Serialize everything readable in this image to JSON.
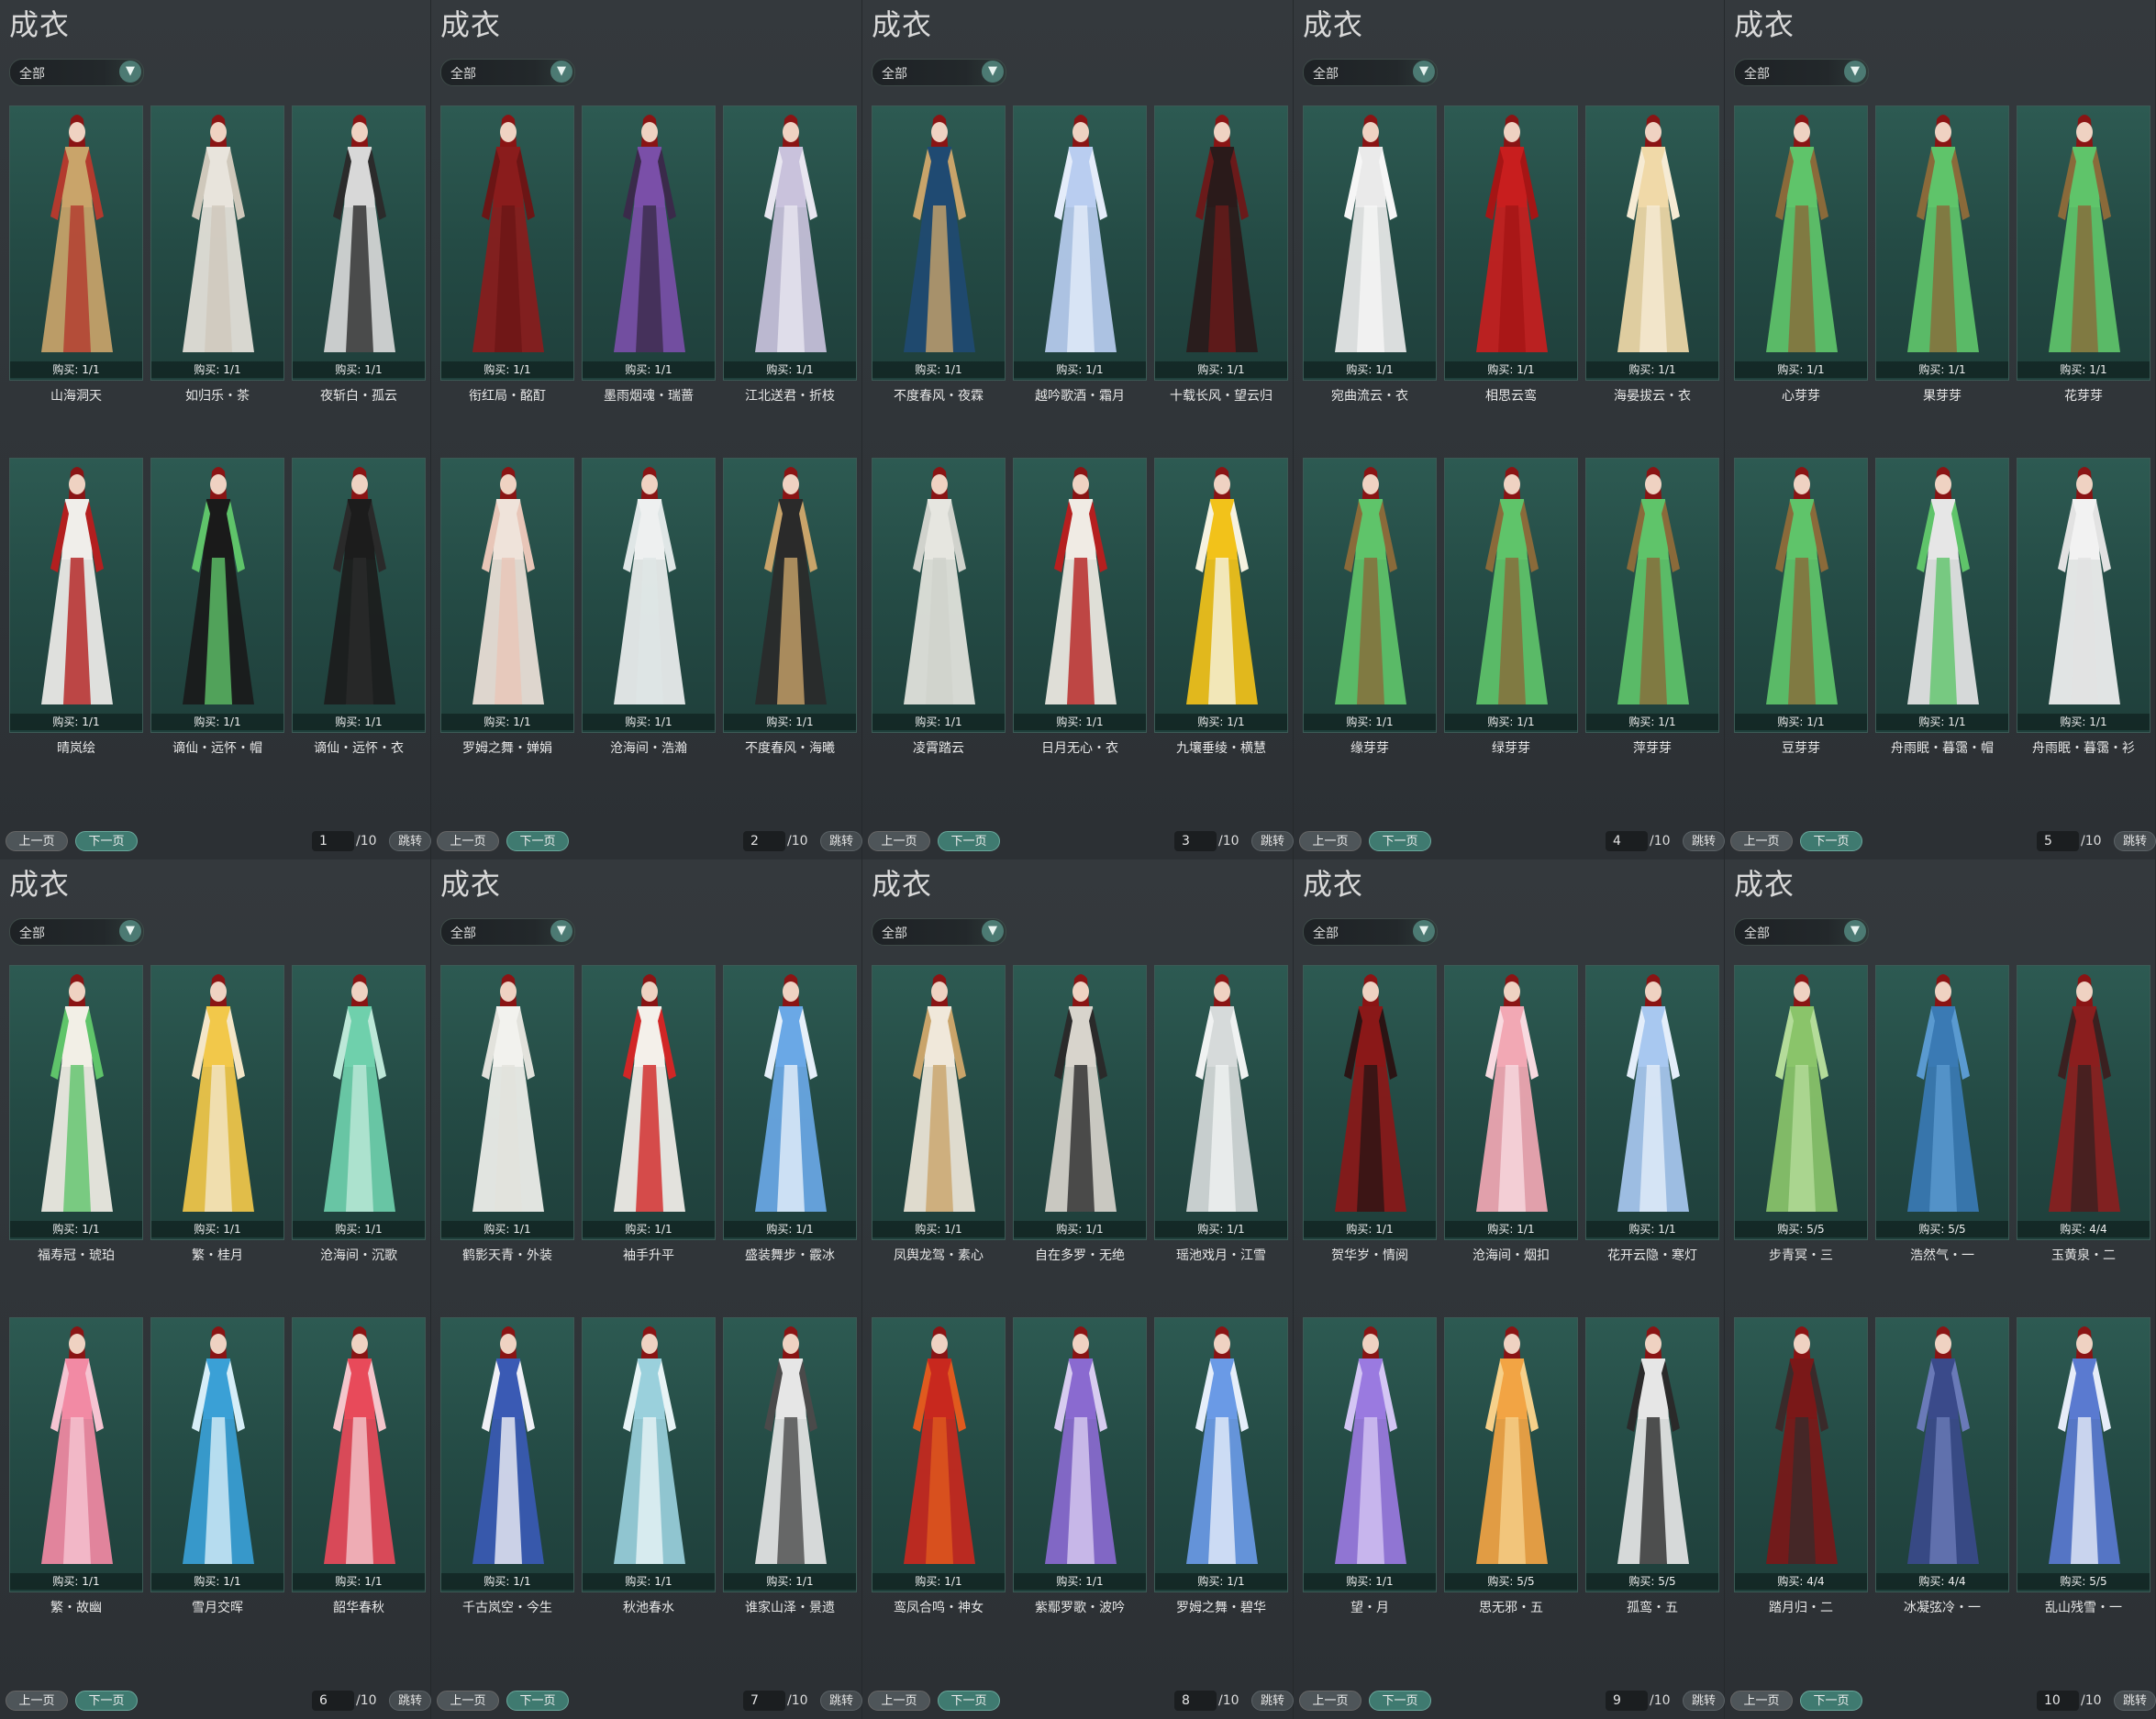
{
  "ui": {
    "title": "成衣",
    "filter_value": "全部",
    "prev_label": "上一页",
    "next_label": "下一页",
    "total_pages": "/10",
    "jump_label": "跳转"
  },
  "pages": [
    {
      "page": "1",
      "items": [
        {
          "name": "山海洞天",
          "buy": "购买: 1/1",
          "colors": [
            "#c9a46a",
            "#b33a2e"
          ]
        },
        {
          "name": "如归乐・茶",
          "buy": "购买: 1/1",
          "colors": [
            "#e8e4dc",
            "#cfc8bb"
          ]
        },
        {
          "name": "夜斩白・孤云",
          "buy": "购买: 1/1",
          "colors": [
            "#d8d8d8",
            "#2b2b2b"
          ]
        },
        {
          "name": "晴岚绘",
          "buy": "购买: 1/1",
          "colors": [
            "#f0eeea",
            "#b31f1f"
          ]
        },
        {
          "name": "谪仙・远怀・帽",
          "buy": "购买: 1/1",
          "colors": [
            "#1a1a1a",
            "#5fc46a"
          ]
        },
        {
          "name": "谪仙・远怀・衣",
          "buy": "购买: 1/1",
          "colors": [
            "#1c1c1c",
            "#2a2a2a"
          ]
        }
      ]
    },
    {
      "page": "2",
      "items": [
        {
          "name": "衔红局・酩酊",
          "buy": "购买: 1/1",
          "colors": [
            "#8a1c1c",
            "#6b1515"
          ]
        },
        {
          "name": "墨雨烟魂・瑞蔷",
          "buy": "购买: 1/1",
          "colors": [
            "#7a4fa8",
            "#3a2a4a"
          ]
        },
        {
          "name": "江北送君・折枝",
          "buy": "购买: 1/1",
          "colors": [
            "#c9c2dc",
            "#e8e6f0"
          ]
        },
        {
          "name": "罗姆之舞・婵娟",
          "buy": "购买: 1/1",
          "colors": [
            "#efe3da",
            "#e8c6b8"
          ]
        },
        {
          "name": "沧海间・浩瀚",
          "buy": "购买: 1/1",
          "colors": [
            "#eef0f0",
            "#dfe6e6"
          ]
        },
        {
          "name": "不度春风・海曦",
          "buy": "购买: 1/1",
          "colors": [
            "#2a2a2a",
            "#c9a46a"
          ]
        }
      ]
    },
    {
      "page": "3",
      "items": [
        {
          "name": "不度春风・夜霖",
          "buy": "购买: 1/1",
          "colors": [
            "#1f4a72",
            "#c9a46a"
          ]
        },
        {
          "name": "越吟歌酒・霜月",
          "buy": "购买: 1/1",
          "colors": [
            "#b9cdf0",
            "#e4ecfa"
          ]
        },
        {
          "name": "十载长风・望云归",
          "buy": "购买: 1/1",
          "colors": [
            "#2a1a1a",
            "#6a1a1a"
          ]
        },
        {
          "name": "凌霄踏云",
          "buy": "购买: 1/1",
          "colors": [
            "#e6e6e0",
            "#d0d2cc"
          ]
        },
        {
          "name": "日月无心・衣",
          "buy": "购买: 1/1",
          "colors": [
            "#f0ebe4",
            "#b51f1f"
          ]
        },
        {
          "name": "九壤垂绫・横慧",
          "buy": "购买: 1/1",
          "colors": [
            "#f2c21a",
            "#f6f2e0"
          ]
        }
      ]
    },
    {
      "page": "4",
      "items": [
        {
          "name": "宛曲流云・衣",
          "buy": "购买: 1/1",
          "colors": [
            "#eaeaea",
            "#f6f6f6"
          ]
        },
        {
          "name": "相思云鸾",
          "buy": "购买: 1/1",
          "colors": [
            "#c81e1e",
            "#a51515"
          ]
        },
        {
          "name": "海晏拔云・衣",
          "buy": "购买: 1/1",
          "colors": [
            "#f0d9a8",
            "#f6ebd4"
          ]
        },
        {
          "name": "缘芽芽",
          "buy": "购买: 1/1",
          "colors": [
            "#5fc46a",
            "#8a6a3a"
          ]
        },
        {
          "name": "绿芽芽",
          "buy": "购买: 1/1",
          "colors": [
            "#5fc46a",
            "#8a6a3a"
          ]
        },
        {
          "name": "萍芽芽",
          "buy": "购买: 1/1",
          "colors": [
            "#5fc46a",
            "#8a6a3a"
          ]
        }
      ]
    },
    {
      "page": "5",
      "items": [
        {
          "name": "心芽芽",
          "buy": "购买: 1/1",
          "colors": [
            "#5fc46a",
            "#8a6a3a"
          ]
        },
        {
          "name": "果芽芽",
          "buy": "购买: 1/1",
          "colors": [
            "#5fc46a",
            "#8a6a3a"
          ]
        },
        {
          "name": "花芽芽",
          "buy": "购买: 1/1",
          "colors": [
            "#5fc46a",
            "#8a6a3a"
          ]
        },
        {
          "name": "豆芽芽",
          "buy": "购买: 1/1",
          "colors": [
            "#5fc46a",
            "#8a6a3a"
          ]
        },
        {
          "name": "舟雨眠・暮霭・帽",
          "buy": "购买: 1/1",
          "colors": [
            "#e6e6e6",
            "#5fc46a"
          ]
        },
        {
          "name": "舟雨眠・暮霭・衫",
          "buy": "购买: 1/1",
          "colors": [
            "#f2f2f2",
            "#e2e2e2"
          ]
        }
      ]
    },
    {
      "page": "6",
      "items": [
        {
          "name": "福寿冠・琥珀",
          "buy": "购买: 1/1",
          "colors": [
            "#f2efe6",
            "#5fc46a"
          ]
        },
        {
          "name": "繁・桂月",
          "buy": "购买: 1/1",
          "colors": [
            "#f2c84a",
            "#f4e6c8"
          ]
        },
        {
          "name": "沧海间・沉歌",
          "buy": "购买: 1/1",
          "colors": [
            "#6fd0ac",
            "#bde8d8"
          ]
        },
        {
          "name": "繁・故幽",
          "buy": "购买: 1/1",
          "colors": [
            "#f28aa4",
            "#f6c4d2"
          ]
        },
        {
          "name": "雪月交晖",
          "buy": "购买: 1/1",
          "colors": [
            "#3aa0d6",
            "#d6eef8"
          ]
        },
        {
          "name": "韶华春秋",
          "buy": "购买: 1/1",
          "colors": [
            "#e84a5a",
            "#f4c6cc"
          ]
        }
      ]
    },
    {
      "page": "7",
      "items": [
        {
          "name": "鹤影天青・外装",
          "buy": "购买: 1/1",
          "colors": [
            "#f2f2ee",
            "#e2e2dc"
          ]
        },
        {
          "name": "袖手升平",
          "buy": "购买: 1/1",
          "colors": [
            "#f4f0ea",
            "#d12626"
          ]
        },
        {
          "name": "盛装舞步・霰冰",
          "buy": "购买: 1/1",
          "colors": [
            "#6aa8e6",
            "#e6f0fa"
          ]
        },
        {
          "name": "千古岚空・今生",
          "buy": "购买: 1/1",
          "colors": [
            "#3a5ab4",
            "#f0f0f6"
          ]
        },
        {
          "name": "秋池春水",
          "buy": "购买: 1/1",
          "colors": [
            "#9ad0dc",
            "#e8f4f6"
          ]
        },
        {
          "name": "谁家山泽・景遗",
          "buy": "购买: 1/1",
          "colors": [
            "#e6e6e6",
            "#4a4a4a"
          ]
        }
      ]
    },
    {
      "page": "8",
      "items": [
        {
          "name": "凤舆龙驾・素心",
          "buy": "购买: 1/1",
          "colors": [
            "#f0e8da",
            "#c9a46a"
          ]
        },
        {
          "name": "自在多罗・无绝",
          "buy": "购买: 1/1",
          "colors": [
            "#d8d4cc",
            "#2a2a2a"
          ]
        },
        {
          "name": "瑶池戏月・江雪",
          "buy": "购买: 1/1",
          "colors": [
            "#d6dada",
            "#f0f2f2"
          ]
        },
        {
          "name": "鸾凤合鸣・神女",
          "buy": "购买: 1/1",
          "colors": [
            "#c8281e",
            "#e05a1e"
          ]
        },
        {
          "name": "紫鄢罗歌・波吟",
          "buy": "购买: 1/1",
          "colors": [
            "#8a6ad0",
            "#d8ccf0"
          ]
        },
        {
          "name": "罗姆之舞・碧华",
          "buy": "购买: 1/1",
          "colors": [
            "#6a9ae6",
            "#e6eefa"
          ]
        }
      ]
    },
    {
      "page": "9",
      "items": [
        {
          "name": "贺华岁・情阅",
          "buy": "购买: 1/1",
          "colors": [
            "#8a1818",
            "#2a1414"
          ]
        },
        {
          "name": "沧海间・烟扣",
          "buy": "购买: 1/1",
          "colors": [
            "#f2a8b4",
            "#f8dae0"
          ]
        },
        {
          "name": "花开云隐・寒灯",
          "buy": "购买: 1/1",
          "colors": [
            "#a8c8f0",
            "#e4eefa"
          ]
        },
        {
          "name": "望・月",
          "buy": "购买: 1/1",
          "colors": [
            "#9a7ae0",
            "#d4c6f4"
          ]
        },
        {
          "name": "思无邪・五",
          "buy": "购买: 5/5",
          "colors": [
            "#f2a444",
            "#f6d08a"
          ]
        },
        {
          "name": "孤鸾・五",
          "buy": "购买: 5/5",
          "colors": [
            "#e6e6e6",
            "#2a2a2a"
          ]
        }
      ]
    },
    {
      "page": "10",
      "items": [
        {
          "name": "步青冥・三",
          "buy": "购买: 5/5",
          "colors": [
            "#8ac46a",
            "#b4dc9a"
          ]
        },
        {
          "name": "浩然气・一",
          "buy": "购买: 5/5",
          "colors": [
            "#3a7ab4",
            "#5a9ad0"
          ]
        },
        {
          "name": "玉黄泉・二",
          "buy": "购买: 4/4",
          "colors": [
            "#8a1e1e",
            "#3a2020"
          ]
        },
        {
          "name": "踏月归・二",
          "buy": "购买: 4/4",
          "colors": [
            "#7a1818",
            "#3a2a2a"
          ]
        },
        {
          "name": "冰凝弦冷・一",
          "buy": "购买: 4/4",
          "colors": [
            "#3a4a8a",
            "#6a7ab8"
          ]
        },
        {
          "name": "乱山残雪・一",
          "buy": "购买: 5/5",
          "colors": [
            "#5a7ad0",
            "#e6ecf8"
          ]
        }
      ]
    }
  ]
}
